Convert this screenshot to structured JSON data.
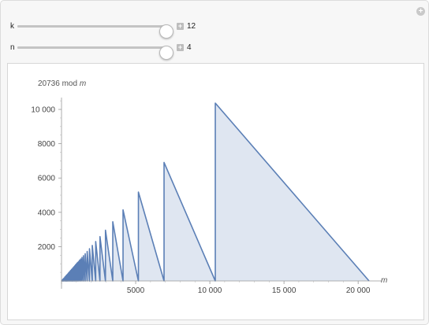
{
  "controls": [
    {
      "label": "k",
      "value": "12",
      "fraction": 0.99
    },
    {
      "label": "n",
      "value": "4",
      "fraction": 0.99
    }
  ],
  "corner_button": "+",
  "chart_data": {
    "type": "area",
    "title": "",
    "ylabel_base": "20736",
    "ylabel_mid": " mod ",
    "ylabel_var": "m",
    "xlabel": "m",
    "xlim": [
      0,
      21000
    ],
    "ylim": [
      0,
      11000
    ],
    "x_ticks": [
      0,
      5000,
      10000,
      15000,
      20000
    ],
    "x_tick_labels": [
      "",
      "5000",
      "10 000",
      "15 000",
      "20 000"
    ],
    "y_ticks": [
      2000,
      4000,
      6000,
      8000,
      10000
    ],
    "y_tick_labels": [
      "2000",
      "4000",
      "6000",
      "8000",
      "10 000"
    ],
    "N": 20736,
    "line_color": "#5b7fb6",
    "fill_color": "#dfe6f1"
  }
}
